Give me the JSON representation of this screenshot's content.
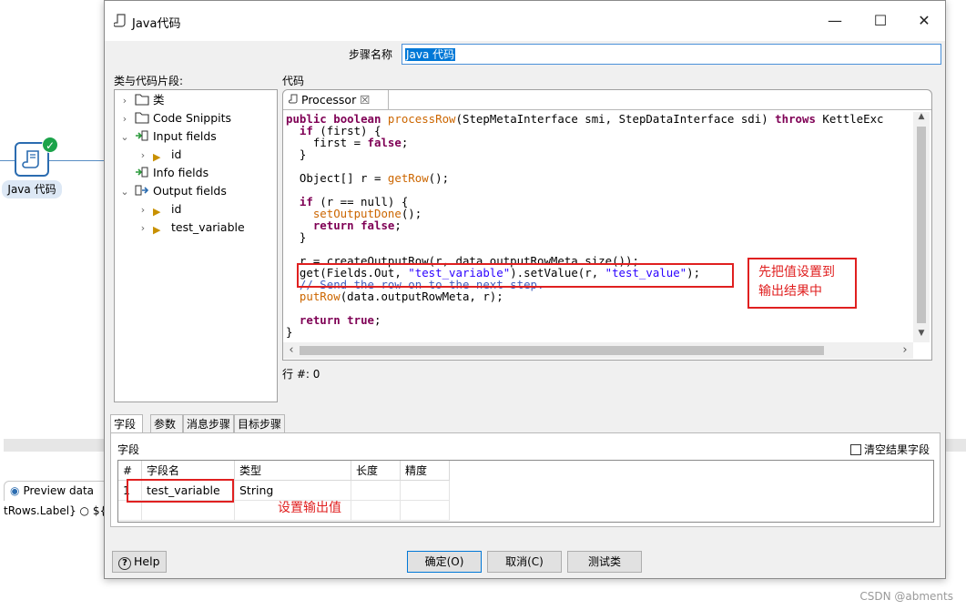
{
  "canvas": {
    "step_label": "Java 代码",
    "preview_tab": "Preview data",
    "bottom_text": "tRows.Label}  ○ ${"
  },
  "watermark": "CSDN @abments",
  "dialog": {
    "title": "Java代码",
    "step_name_label": "步骤名称",
    "step_name_value": "Java 代码",
    "left_panel_title": "类与代码片段:",
    "right_panel_title": "代码",
    "tree": [
      {
        "label": "类"
      },
      {
        "label": "Code Snippits"
      },
      {
        "label": "Input fields"
      },
      {
        "label": "id"
      },
      {
        "label": "Info fields"
      },
      {
        "label": "Output fields"
      },
      {
        "label": "id"
      },
      {
        "label": "test_variable"
      }
    ],
    "editor_tab": "Processor",
    "code_lines": [
      "public boolean processRow(StepMetaInterface smi, StepDataInterface sdi) throws KettleExc",
      "  if (first) {",
      "    first = false;",
      "  }",
      "",
      "  Object[] r = getRow();",
      "",
      "  if (r == null) {",
      "    setOutputDone();",
      "    return false;",
      "  }",
      "",
      "  r = createOutputRow(r, data.outputRowMeta.size());",
      "  get(Fields.Out, \"test_variable\").setValue(r, \"test_value\");",
      "  // Send the row on to the next step.",
      "  putRow(data.outputRowMeta, r);",
      "",
      "  return true;",
      "}"
    ],
    "row_count": "行 #: 0",
    "annotation_code": "先把值设置到\n输出结果中",
    "annotation_field": "设置输出值",
    "bottom_tabs": [
      "字段",
      "参数",
      "消息步骤",
      "目标步骤"
    ],
    "fields_label": "字段",
    "clear_result_label": "清空结果字段",
    "grid_headers": [
      "#",
      "字段名",
      "类型",
      "长度",
      "精度"
    ],
    "grid_rows": [
      {
        "num": "1",
        "name": "test_variable",
        "type": "String",
        "length": "",
        "precision": ""
      }
    ],
    "help_button": "Help",
    "ok_button": "确定(O)",
    "cancel_button": "取消(C)",
    "test_button": "测试类"
  }
}
